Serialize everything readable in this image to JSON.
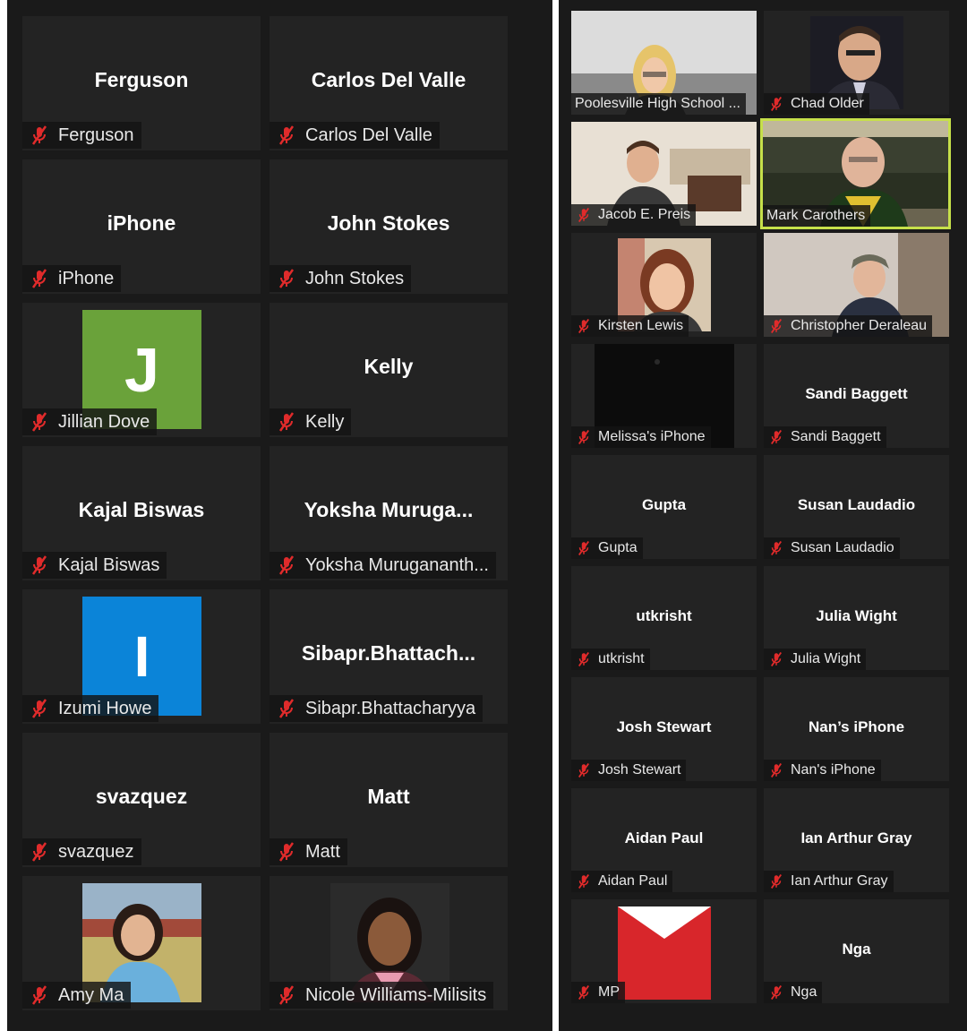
{
  "colors": {
    "mic_muted": "#e02b2b",
    "active_speaker_border": "#c6e04a",
    "avatar_j": "#6aa23a",
    "avatar_i": "#0b84d8",
    "mp_red": "#d8262b"
  },
  "left": {
    "tiles": [
      {
        "center": "Ferguson",
        "label": "Ferguson"
      },
      {
        "center": "Carlos Del Valle",
        "label": "Carlos Del Valle"
      },
      {
        "center": "iPhone",
        "label": "iPhone"
      },
      {
        "center": "John Stokes",
        "label": "John Stokes"
      },
      {
        "avatar_letter": "J",
        "label": "Jillian Dove"
      },
      {
        "center": "Kelly",
        "label": "Kelly"
      },
      {
        "center": "Kajal Biswas",
        "label": "Kajal Biswas"
      },
      {
        "center": "Yoksha  Muruga...",
        "label": "Yoksha Murugananth..."
      },
      {
        "avatar_letter": "I",
        "label": "Izumi Howe"
      },
      {
        "center": "Sibapr.Bhattach...",
        "label": "Sibapr.Bhattacharyya"
      },
      {
        "center": "svazquez",
        "label": "svazquez"
      },
      {
        "center": "Matt",
        "label": "Matt"
      },
      {
        "label": "Amy Ma"
      },
      {
        "label": "Nicole Williams-Milisits"
      }
    ]
  },
  "right": {
    "tiles": [
      {
        "label": "Poolesville High School ..."
      },
      {
        "label": "Chad Older"
      },
      {
        "label": "Jacob E. Preis"
      },
      {
        "label": "Mark Carothers"
      },
      {
        "label": "Kirsten Lewis"
      },
      {
        "label": "Christopher Deraleau"
      },
      {
        "label": "Melissa's iPhone"
      },
      {
        "center": "Sandi Baggett",
        "label": "Sandi Baggett"
      },
      {
        "center": "Gupta",
        "label": "Gupta"
      },
      {
        "center": "Susan Laudadio",
        "label": "Susan Laudadio"
      },
      {
        "center": "utkrisht",
        "label": "utkrisht"
      },
      {
        "center": "Julia Wight",
        "label": "Julia Wight"
      },
      {
        "center": "Josh Stewart",
        "label": "Josh Stewart"
      },
      {
        "center": "Nan’s iPhone",
        "label": "Nan's iPhone"
      },
      {
        "center": "Aidan Paul",
        "label": "Aidan Paul"
      },
      {
        "center": "Ian Arthur Gray",
        "label": "Ian Arthur Gray"
      },
      {
        "label": "MP"
      },
      {
        "center": "Nga",
        "label": "Nga"
      }
    ]
  }
}
